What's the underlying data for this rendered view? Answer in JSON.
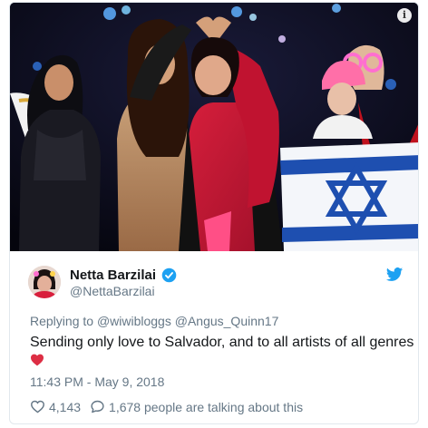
{
  "tweet": {
    "display_name": "Netta Barzilai",
    "handle": "@NettaBarzilai",
    "reply_prefix": "Replying to",
    "reply_to": "@wiwibloggs @Angus_Quinn17",
    "text": "Sending only love to Salvador, and to all artists of all genres",
    "emoji": "red-heart",
    "timestamp": "11:43 PM - May 9, 2018",
    "likes": "4,143",
    "talking": "1,678 people are talking about this"
  },
  "icons": {
    "info": "info-icon",
    "verified": "verified-badge-icon",
    "twitter": "twitter-bird-icon",
    "like": "heart-outline-icon",
    "reply": "speech-bubble-icon"
  },
  "colors": {
    "twitter_blue": "#1da1f2",
    "text_secondary": "#657786",
    "heart_red": "#e0245e",
    "flag_blue": "#1e4fb0"
  }
}
